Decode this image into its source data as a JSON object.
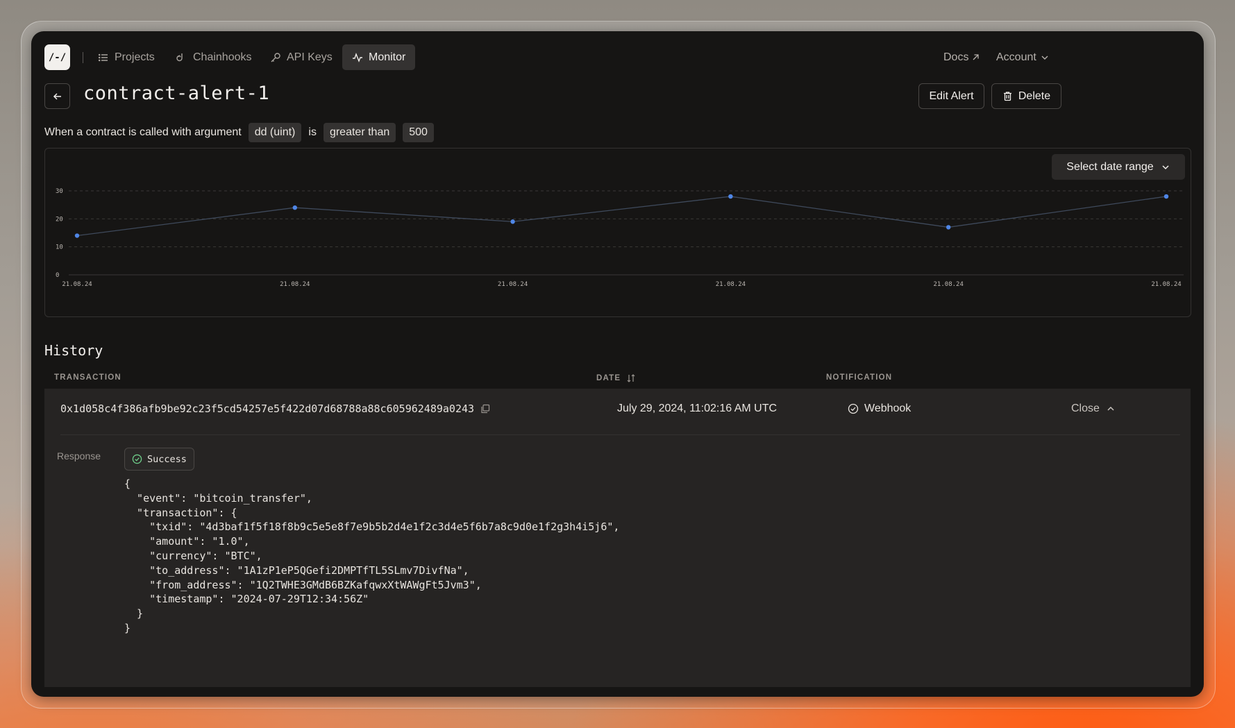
{
  "app": {
    "logo_text": "/-/"
  },
  "nav": {
    "items": [
      {
        "label": "Projects",
        "icon": "list-icon"
      },
      {
        "label": "Chainhooks",
        "icon": "hook-icon"
      },
      {
        "label": "API Keys",
        "icon": "key-icon"
      },
      {
        "label": "Monitor",
        "icon": "activity-icon",
        "active": true
      }
    ],
    "docs_label": "Docs",
    "account_label": "Account"
  },
  "header": {
    "title": "contract-alert-1",
    "edit_label": "Edit Alert",
    "delete_label": "Delete"
  },
  "condition": {
    "prefix": "When a contract is called with argument",
    "argument": "dd (uint)",
    "connector": "is",
    "operator": "greater than",
    "value": "500"
  },
  "date_range": {
    "label": "Select date range"
  },
  "chart_data": {
    "type": "line",
    "x": [
      "21.08.24",
      "21.08.24",
      "21.08.24",
      "21.08.24",
      "21.08.24",
      "21.08.24"
    ],
    "values": [
      14,
      24,
      19,
      28,
      17,
      28
    ],
    "ylim": [
      0,
      30
    ],
    "yticks": [
      0,
      10,
      20,
      30
    ],
    "grid": true,
    "line_color": "#3f4a5c",
    "point_color": "#4f86e6"
  },
  "history": {
    "title": "History",
    "columns": {
      "transaction": "TRANSACTION",
      "date": "DATE",
      "notification": "NOTIFICATION"
    },
    "rows": [
      {
        "txid": "0x1d058c4f386afb9be92c23f5cd54257e5f422d07d68788a88c605962489a0243",
        "date": "July 29, 2024, 11:02:16 AM UTC",
        "notification": "Webhook",
        "action": "Close",
        "response_label": "Response",
        "status": "Success",
        "json_lines": [
          "{",
          "  \"event\": \"bitcoin_transfer\",",
          "  \"transaction\": {",
          "    \"txid\": \"4d3baf1f5f18f8b9c5e5e8f7e9b5b2d4e1f2c3d4e5f6b7a8c9d0e1f2g3h4i5j6\",",
          "    \"amount\": \"1.0\",",
          "    \"currency\": \"BTC\",",
          "    \"to_address\": \"1A1zP1eP5QGefi2DMPTfTL5SLmv7DivfNa\",",
          "    \"from_address\": \"1Q2TWHE3GMdB6BZKafqwxXtWAWgFt5Jvm3\",",
          "    \"timestamp\": \"2024-07-29T12:34:56Z\"",
          "  }",
          "}"
        ]
      }
    ]
  }
}
